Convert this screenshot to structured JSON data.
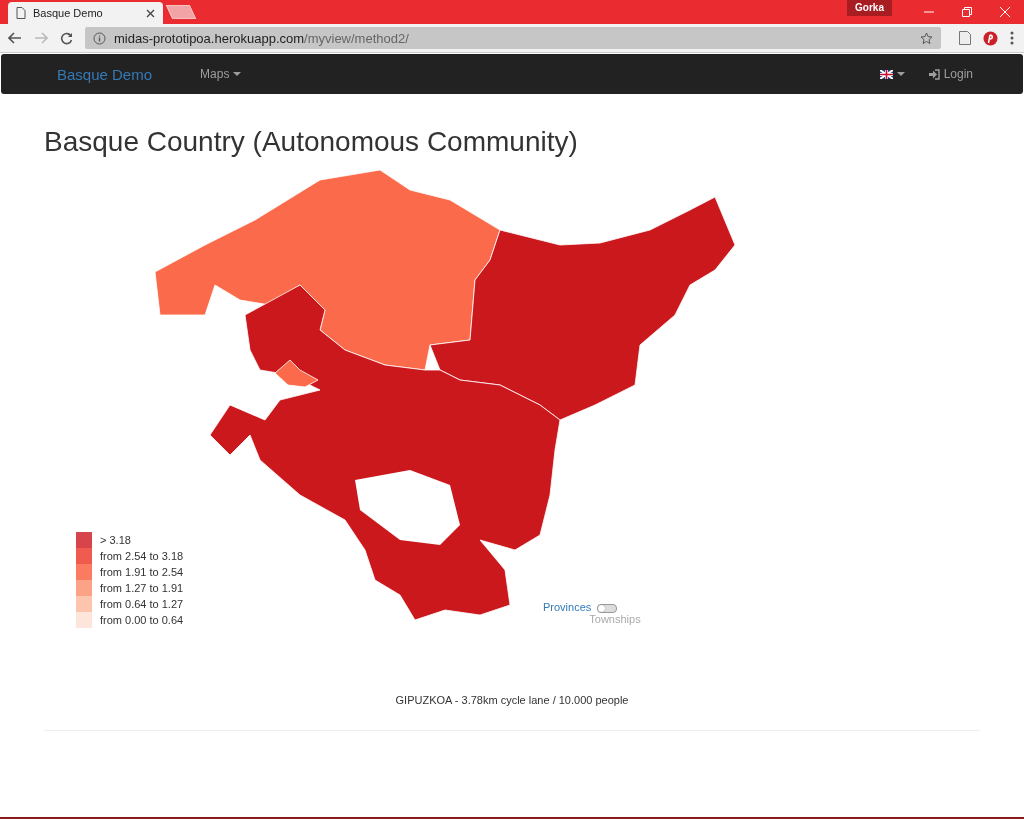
{
  "browser": {
    "tab_title": "Basque Demo",
    "profile": "Gorka",
    "url_host": "midas-prototipoa.herokuapp.com",
    "url_path": "/myview/method2/"
  },
  "navbar": {
    "brand": "Basque Demo",
    "menu": "Maps",
    "login": "Login"
  },
  "title": "Basque Country (Autonomous Community)",
  "map": {
    "regions": [
      {
        "color": "#fb6a4a"
      },
      {
        "color": "#cb181d"
      },
      {
        "color": "#cb181d"
      },
      {
        "color": "#fb6a4a"
      }
    ],
    "legend": [
      {
        "label": "> 3.18",
        "color": "#d7444c"
      },
      {
        "label": "from 2.54 to 3.18",
        "color": "#ef5c4f"
      },
      {
        "label": "from 1.91 to 2.54",
        "color": "#fb7b60"
      },
      {
        "label": "from 1.27 to 1.91",
        "color": "#fca286"
      },
      {
        "label": "from 0.64 to 1.27",
        "color": "#fdc4ae"
      },
      {
        "label": "from 0.00 to 0.64",
        "color": "#fee5db"
      }
    ],
    "toggle": {
      "left": "Provinces",
      "right": "Townships",
      "on": false
    }
  },
  "caption": "GIPUZKOA - 3.78km cycle lane / 10.000 people"
}
